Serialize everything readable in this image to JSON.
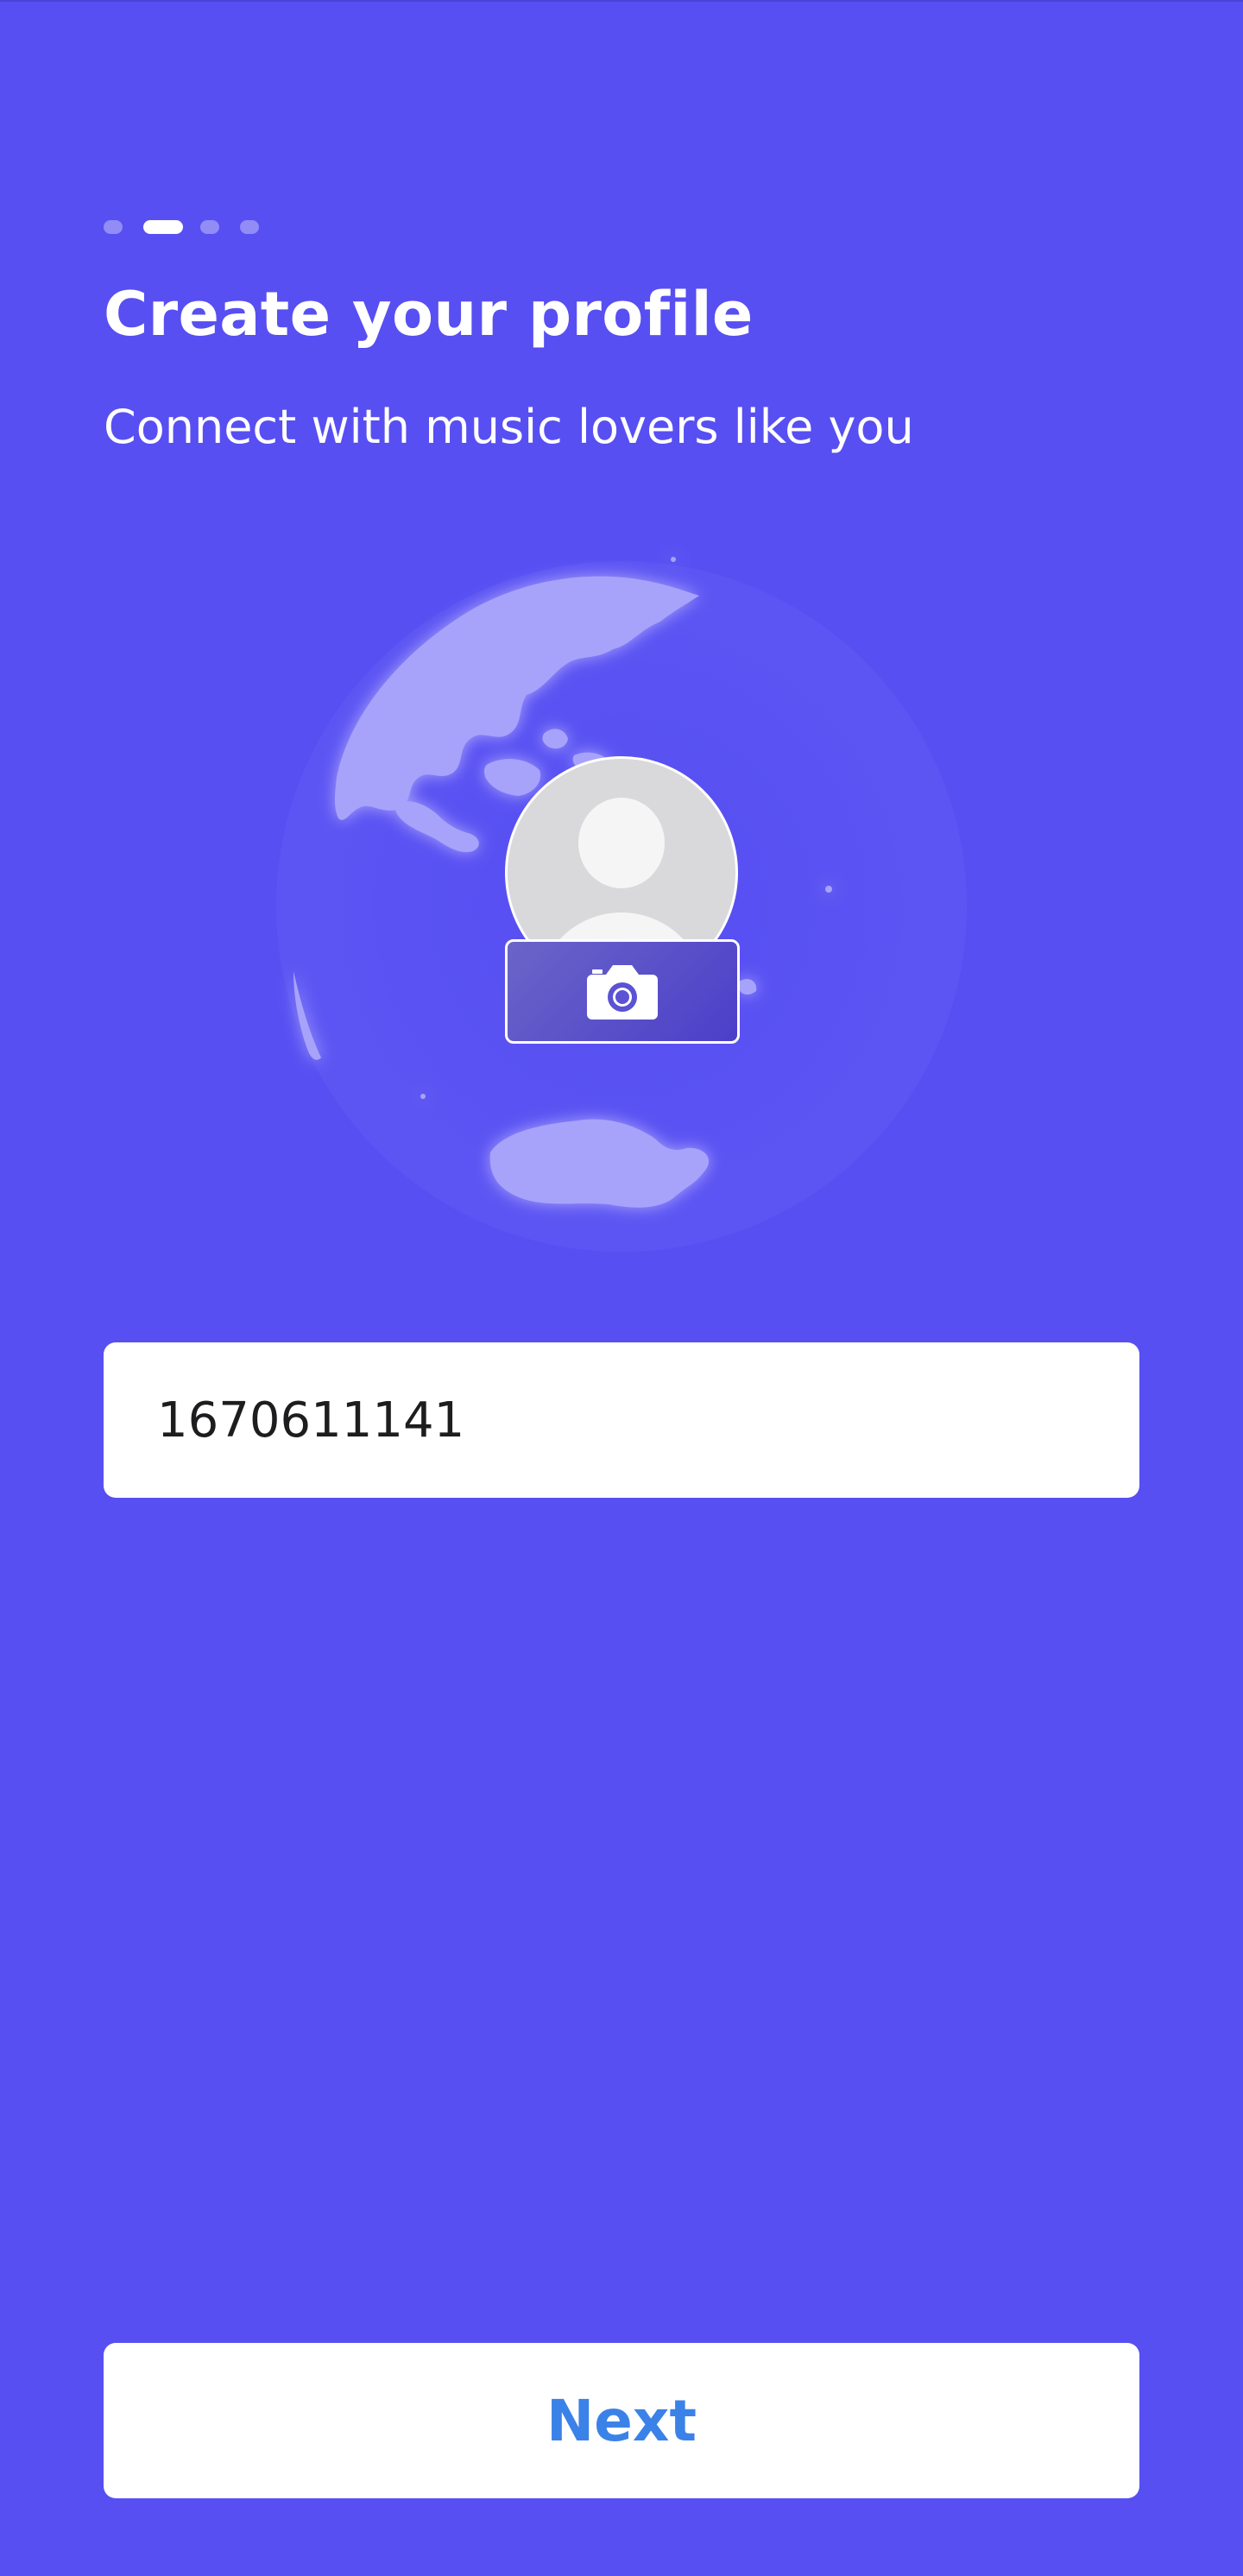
{
  "header": {
    "progress_steps": 4,
    "progress_current": 2,
    "title": "Create your profile",
    "subtitle": "Connect with music lovers like you"
  },
  "avatar": {
    "icon": "user-avatar-icon",
    "upload_icon": "camera-icon"
  },
  "form": {
    "username_value": "1670611141"
  },
  "footer": {
    "next_label": "Next"
  },
  "colors": {
    "background": "#574ff2",
    "button_text": "#3b82e8",
    "globe_land": "#a7a3fb"
  }
}
